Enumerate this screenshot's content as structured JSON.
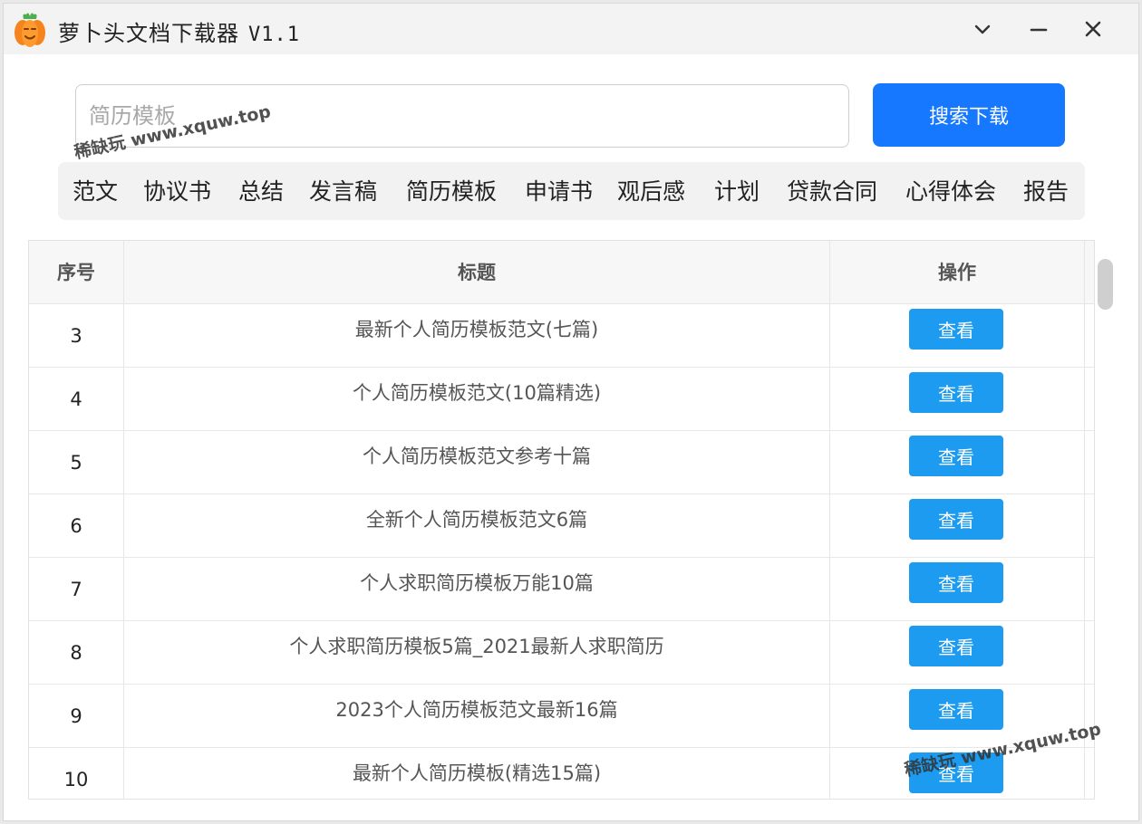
{
  "window": {
    "title": "萝卜头文档下载器",
    "version": "V1.1"
  },
  "search": {
    "placeholder": "简历模板",
    "button_label": "搜索下载"
  },
  "watermark": "稀缺玩 www.xquw.top",
  "categories": [
    "范文",
    "协议书",
    "总结",
    "发言稿",
    "简历模板",
    "申请书",
    "观后感",
    "计划",
    "贷款合同",
    "心得体会",
    "报告"
  ],
  "table": {
    "headers": [
      "序号",
      "标题",
      "操作"
    ],
    "rows": [
      {
        "no": "3",
        "title": "最新个人简历模板范文(七篇)",
        "action": "查看"
      },
      {
        "no": "4",
        "title": "个人简历模板范文(10篇精选)",
        "action": "查看"
      },
      {
        "no": "5",
        "title": "个人简历模板范文参考十篇",
        "action": "查看"
      },
      {
        "no": "6",
        "title": "全新个人简历模板范文6篇",
        "action": "查看"
      },
      {
        "no": "7",
        "title": "个人求职简历模板万能10篇",
        "action": "查看"
      },
      {
        "no": "8",
        "title": "个人求职简历模板5篇_2021最新人求职简历",
        "action": "查看"
      },
      {
        "no": "9",
        "title": "2023个人简历模板范文最新16篇",
        "action": "查看"
      },
      {
        "no": "10",
        "title": "最新个人简历模板(精选15篇)",
        "action": "查看"
      }
    ]
  },
  "colors": {
    "primary": "#1677ff",
    "view_button": "#1d9bf0",
    "logo_orange": "#f5841f"
  }
}
